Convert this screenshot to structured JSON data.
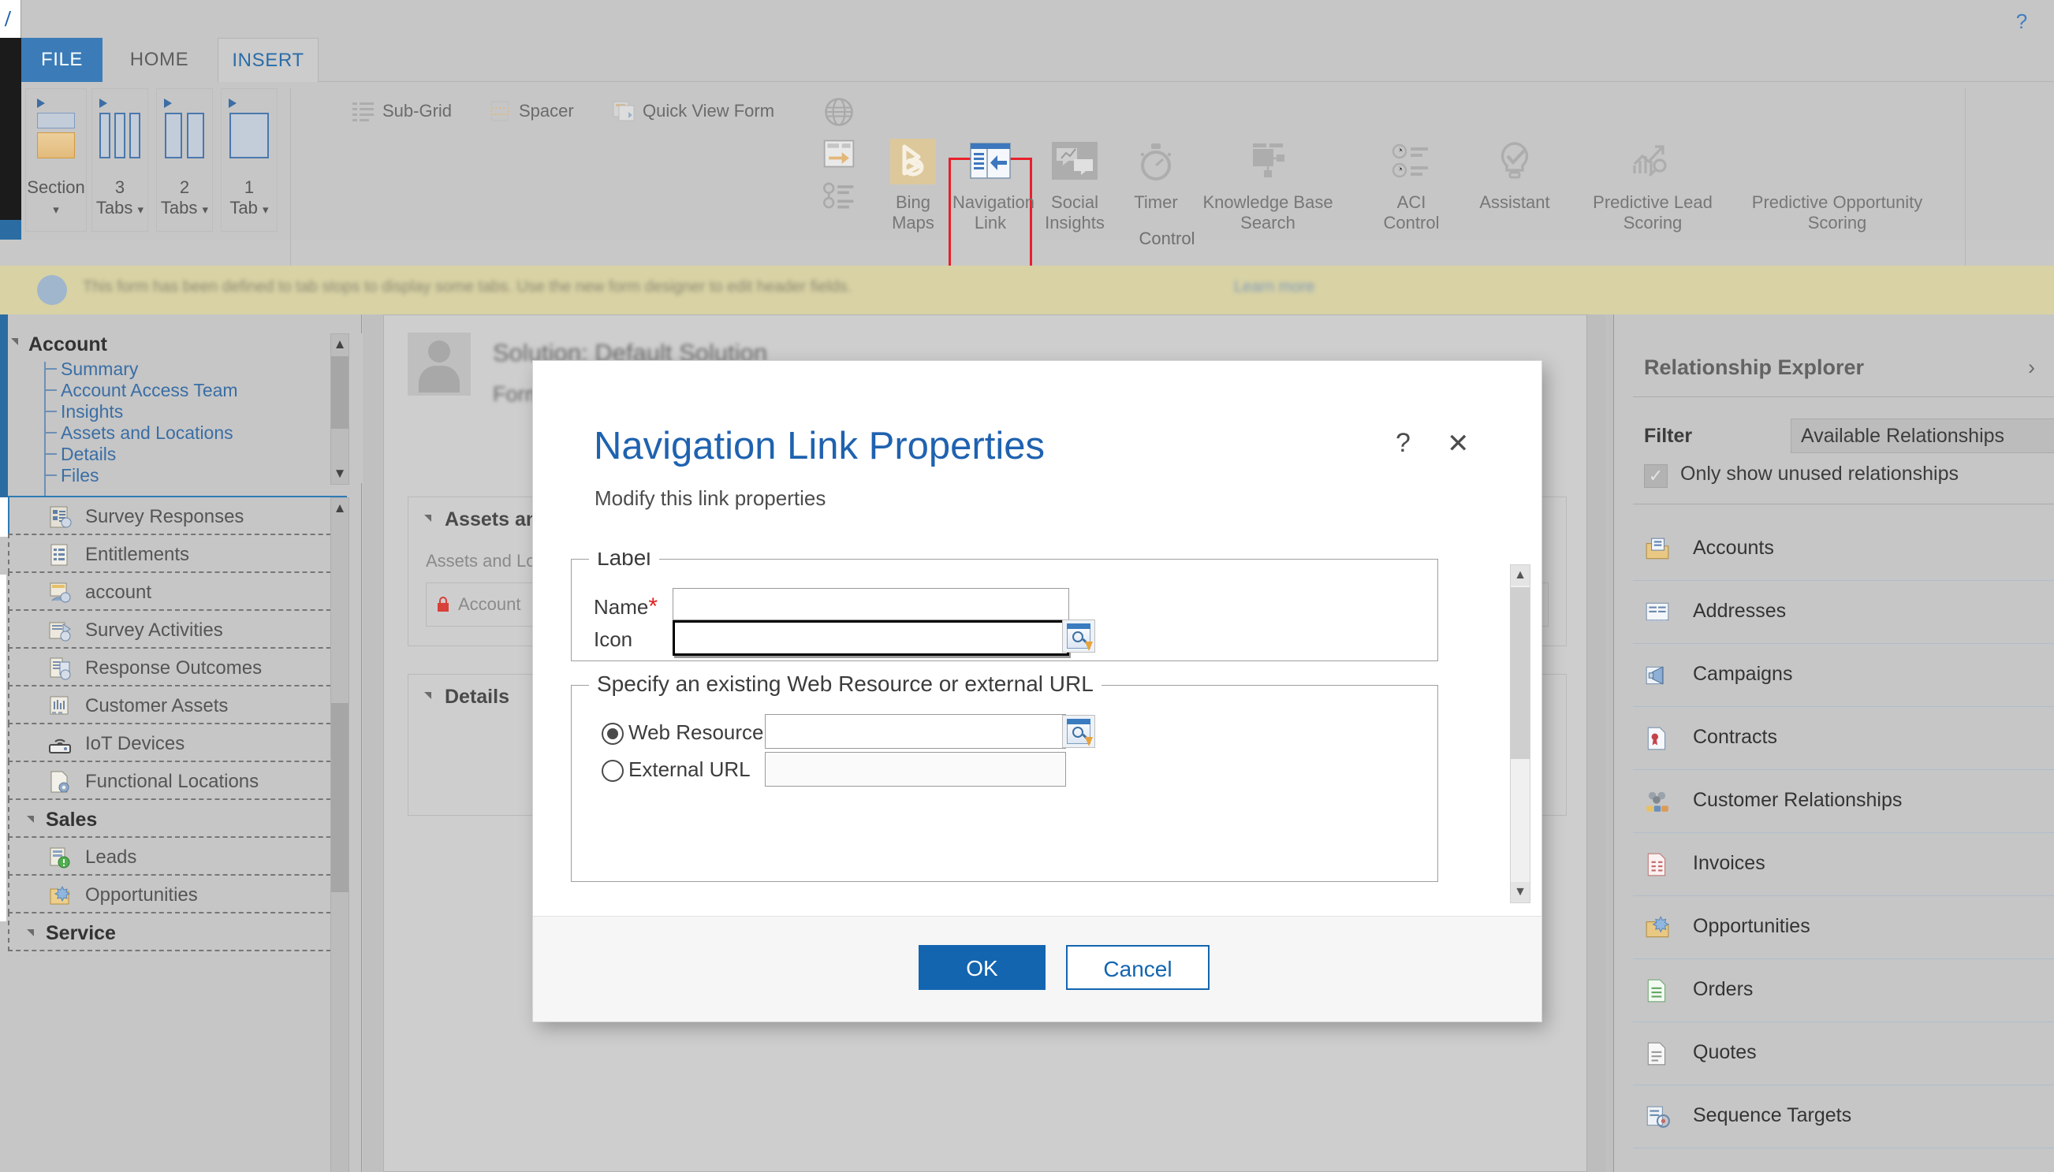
{
  "window": {
    "help_icon": "?",
    "edge_letter": "/"
  },
  "ribbon": {
    "tabs": [
      {
        "label": "FILE",
        "state": "file"
      },
      {
        "label": "HOME",
        "state": "normal"
      },
      {
        "label": "INSERT",
        "state": "active"
      }
    ],
    "layout_buttons": [
      {
        "label": "Section",
        "sub": "",
        "icon": "section-icon",
        "caret": "▾"
      },
      {
        "label": "3",
        "sub": "Tabs",
        "icon": "three-tabs-icon",
        "caret": "▾"
      },
      {
        "label": "2",
        "sub": "Tabs",
        "icon": "two-tabs-icon",
        "caret": "▾"
      },
      {
        "label": "1",
        "sub": "Tab",
        "icon": "one-tab-icon",
        "caret": "▾"
      }
    ],
    "small_commands": [
      {
        "label": "Sub-Grid",
        "icon": "sub-grid-icon"
      },
      {
        "label": "Spacer",
        "icon": "spacer-icon"
      },
      {
        "label": "Quick View Form",
        "icon": "quick-view-form-icon"
      }
    ],
    "stack_icons": [
      {
        "icon": "iframe-globe-icon"
      },
      {
        "icon": "web-resource-icon"
      },
      {
        "icon": "timeline-icon"
      }
    ],
    "controls": [
      {
        "label": "Bing\nMaps",
        "icon": "bing-maps-icon",
        "selected": false
      },
      {
        "label": "Navigation\nLink",
        "icon": "navigation-link-icon",
        "selected": true
      },
      {
        "label": "Social\nInsights",
        "icon": "social-insights-icon",
        "selected": false
      },
      {
        "label": "Timer",
        "icon": "timer-icon",
        "selected": false
      },
      {
        "label": "Knowledge Base\nSearch",
        "icon": "knowledge-base-search-icon",
        "selected": false
      },
      {
        "label": "ACI\nControl",
        "icon": "aci-control-icon",
        "selected": false
      },
      {
        "label": "Assistant",
        "icon": "assistant-icon",
        "selected": false
      },
      {
        "label": "Predictive Lead\nScoring",
        "icon": "predictive-lead-scoring-icon",
        "selected": false
      },
      {
        "label": "Predictive Opportunity\nScoring",
        "icon": "predictive-opportunity-scoring-icon",
        "selected": false
      }
    ],
    "group_caption": "Control",
    "selection_color": "#e8202a"
  },
  "notification": {
    "message": "This form has been defined to tab stops to display some tabs. Use the new form designer to edit header fields.",
    "link": "Learn more",
    "icon": "info-icon"
  },
  "left_nav": {
    "tree": {
      "root": "Account",
      "items": [
        "Summary",
        "Account Access Team",
        "Insights",
        "Assets and Locations",
        "Details",
        "Files"
      ]
    },
    "scroll": {
      "up": "▲",
      "down": "▼"
    },
    "list": [
      {
        "label": "Survey Responses",
        "icon": "survey-responses-icon",
        "type": "item",
        "selected": true
      },
      {
        "label": "Entitlements",
        "icon": "entitlements-icon",
        "type": "item",
        "selected": false
      },
      {
        "label": "account",
        "icon": "account-icon",
        "type": "item",
        "selected": false
      },
      {
        "label": "Survey Activities",
        "icon": "survey-activities-icon",
        "type": "item",
        "selected": false
      },
      {
        "label": "Response Outcomes",
        "icon": "response-outcomes-icon",
        "type": "item",
        "selected": false
      },
      {
        "label": "Customer Assets",
        "icon": "customer-assets-icon",
        "type": "item",
        "selected": false
      },
      {
        "label": "IoT Devices",
        "icon": "iot-devices-icon",
        "type": "item",
        "selected": false
      },
      {
        "label": "Functional Locations",
        "icon": "functional-locations-icon",
        "type": "item",
        "selected": false
      },
      {
        "label": "Sales",
        "icon": "",
        "type": "header",
        "selected": false
      },
      {
        "label": "Leads",
        "icon": "leads-icon",
        "type": "item",
        "selected": false
      },
      {
        "label": "Opportunities",
        "icon": "opportunities-icon",
        "type": "item",
        "selected": false
      },
      {
        "label": "Service",
        "icon": "",
        "type": "header",
        "selected": false
      }
    ]
  },
  "canvas": {
    "solution_line": "Solution: Default Solution",
    "form_line": "Form: Account",
    "sections": [
      {
        "title": "Assets and Locations",
        "sub": "Assets and Locations",
        "locked": "Account"
      },
      {
        "title": "Details",
        "sub": "",
        "locked": ""
      }
    ]
  },
  "right_panel": {
    "title": "Relationship Explorer",
    "chevron": "›",
    "filter_label": "Filter",
    "filter_value": "Available Relationships",
    "filter_chevron": "∨",
    "checkbox_checked": true,
    "checkbox_mark": "✓",
    "checkbox_label": "Only show unused relationships",
    "rows": [
      {
        "label": "Accounts",
        "icon": "accounts-icon"
      },
      {
        "label": "Addresses",
        "icon": "addresses-icon"
      },
      {
        "label": "Campaigns",
        "icon": "campaigns-icon"
      },
      {
        "label": "Contracts",
        "icon": "contracts-icon"
      },
      {
        "label": "Customer Relationships",
        "icon": "customer-relationships-icon"
      },
      {
        "label": "Invoices",
        "icon": "invoices-icon"
      },
      {
        "label": "Opportunities",
        "icon": "opportunities-icon"
      },
      {
        "label": "Orders",
        "icon": "orders-icon"
      },
      {
        "label": "Quotes",
        "icon": "quotes-icon"
      },
      {
        "label": "Sequence Targets",
        "icon": "sequence-targets-icon"
      }
    ]
  },
  "dialog": {
    "title": "Navigation Link Properties",
    "subtitle": "Modify this link properties",
    "help_glyph": "?",
    "close_glyph": "✕",
    "label_group": {
      "legend": "Label",
      "name_label": "Name",
      "name_required": "*",
      "name_value": "",
      "icon_label": "Icon",
      "icon_value": "",
      "lookup_icon": "lookup-browse-icon"
    },
    "resource_group": {
      "legend": "Specify an existing Web Resource or external URL",
      "web_resource_label": "Web Resource",
      "web_resource_value": "",
      "web_resource_selected": true,
      "external_url_label": "External URL",
      "external_url_value": "",
      "external_url_selected": false,
      "lookup_icon": "lookup-browse-icon"
    },
    "scrollbar": {
      "up": "▲",
      "down": "▼"
    },
    "ok_label": "OK",
    "cancel_label": "Cancel",
    "accent_color": "#1365b0"
  }
}
